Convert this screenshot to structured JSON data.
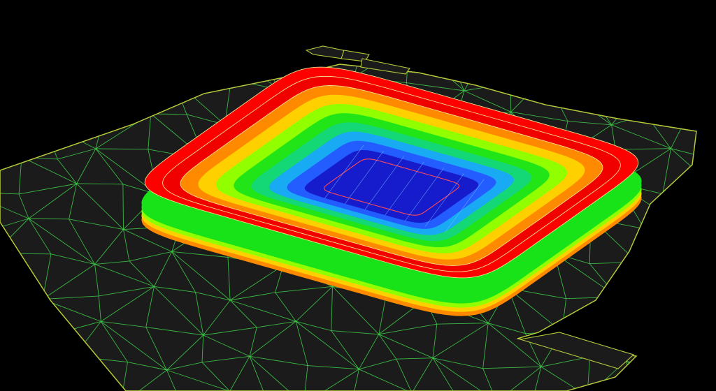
{
  "viewport": {
    "background_color": "#000000"
  },
  "terrain_mesh": {
    "fill_color": "#1b1b1b",
    "wire_color": "#3fd44a",
    "edge_color": "#b7c93a",
    "icon": "triangulated-mesh-icon"
  },
  "excavation_pit": {
    "contour_colors": [
      "#ff0000",
      "#f10000",
      "#ff8a00",
      "#ffd000",
      "#92ff00",
      "#18e318",
      "#14d67e",
      "#1aa6ff",
      "#2456ff",
      "#1616c8"
    ],
    "contour_line_color": "#f3e08b",
    "floor_outline_color": "#ff4a54",
    "band_count": 10,
    "icon": "stadium-bowl-icon"
  }
}
